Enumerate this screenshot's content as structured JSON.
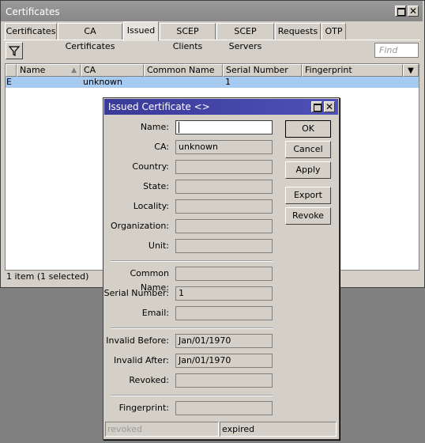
{
  "window": {
    "title": "Certificates"
  },
  "tabs": [
    {
      "label": "Certificates"
    },
    {
      "label": "CA Certificates"
    },
    {
      "label": "Issued"
    },
    {
      "label": "SCEP Clients"
    },
    {
      "label": "SCEP Servers"
    },
    {
      "label": "Requests"
    },
    {
      "label": "OTP"
    }
  ],
  "active_tab": "Issued",
  "toolbar": {
    "filter_icon": "filter-icon",
    "find_placeholder": "Find"
  },
  "table": {
    "columns": [
      "Name",
      "CA",
      "Common Name",
      "Serial Number",
      "Fingerprint"
    ],
    "sort_column": "Name",
    "rows": [
      {
        "flag": "E",
        "name": "",
        "ca": "unknown",
        "common_name": "",
        "serial_number": "1",
        "fingerprint": ""
      }
    ]
  },
  "status": "1 item (1 selected)",
  "dialog": {
    "title": "Issued Certificate <>",
    "fields": {
      "name": {
        "label": "Name:",
        "value": ""
      },
      "ca": {
        "label": "CA:",
        "value": "unknown"
      },
      "country": {
        "label": "Country:",
        "value": ""
      },
      "state": {
        "label": "State:",
        "value": ""
      },
      "locality": {
        "label": "Locality:",
        "value": ""
      },
      "organization": {
        "label": "Organization:",
        "value": ""
      },
      "unit": {
        "label": "Unit:",
        "value": ""
      },
      "common_name": {
        "label": "Common Name:",
        "value": ""
      },
      "serial_number": {
        "label": "Serial Number:",
        "value": "1"
      },
      "email": {
        "label": "Email:",
        "value": ""
      },
      "invalid_before": {
        "label": "Invalid Before:",
        "value": "Jan/01/1970"
      },
      "invalid_after": {
        "label": "Invalid After:",
        "value": "Jan/01/1970"
      },
      "revoked": {
        "label": "Revoked:",
        "value": ""
      },
      "fingerprint": {
        "label": "Fingerprint:",
        "value": ""
      }
    },
    "buttons": {
      "ok": "OK",
      "cancel": "Cancel",
      "apply": "Apply",
      "export": "Export",
      "revoke": "Revoke"
    },
    "status_left": "revoked",
    "status_right": "expired"
  }
}
